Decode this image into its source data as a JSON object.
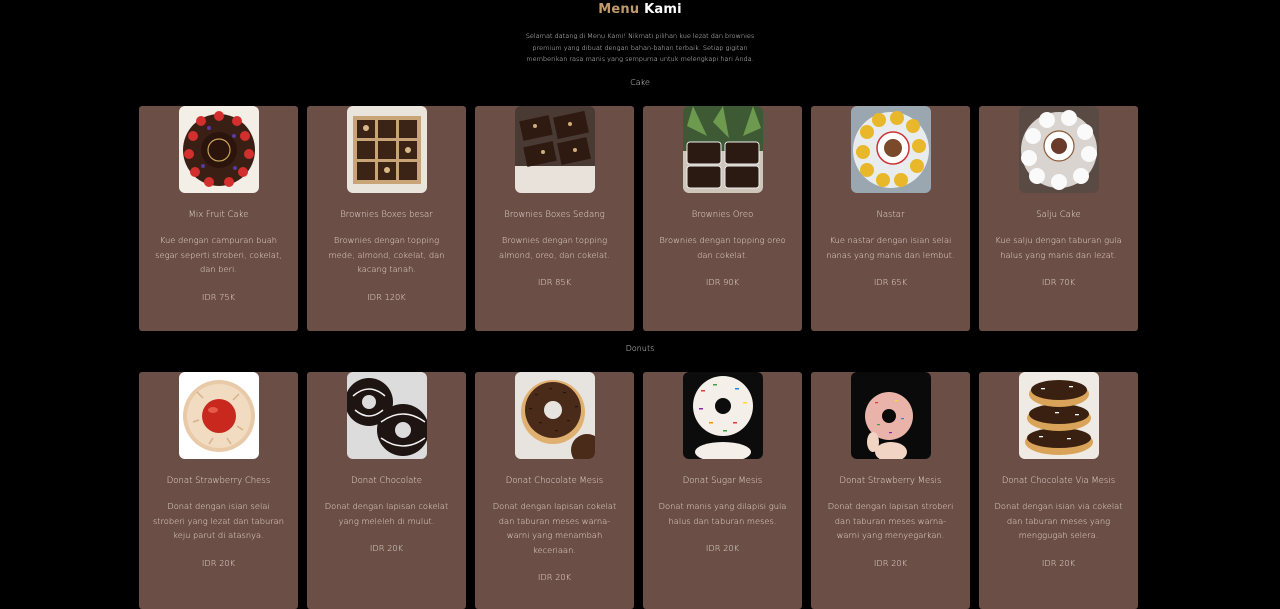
{
  "header": {
    "title_accent": "Menu",
    "title_rest": "Kami",
    "intro": "Selamat datang di Menu Kami! Nikmati pilihan kue lezat dan brownies premium yang dibuat dengan bahan-bahan terbaik. Setiap gigitan memberikan rasa manis yang sempurna untuk melengkapi hari Anda."
  },
  "sections": [
    {
      "label": "Cake",
      "items": [
        {
          "name": "Mix Fruit Cake",
          "desc": "Kue dengan campuran buah segar seperti stroberi, cokelat, dan beri.",
          "price": "IDR 75K"
        },
        {
          "name": "Brownies Boxes besar",
          "desc": "Brownies dengan topping mede, almond, cokelat, dan kacang tanah.",
          "price": "IDR 120K"
        },
        {
          "name": "Brownies Boxes Sedang",
          "desc": "Brownies dengan topping almond, oreo, dan cokelat.",
          "price": "IDR 85K"
        },
        {
          "name": "Brownies Oreo",
          "desc": "Brownies dengan topping oreo dan cokelat.",
          "price": "IDR 90K"
        },
        {
          "name": "Nastar",
          "desc": "Kue nastar dengan isian selai nanas yang manis dan lembut.",
          "price": "IDR 65K"
        },
        {
          "name": "Salju Cake",
          "desc": "Kue salju dengan taburan gula halus yang manis dan lezat.",
          "price": "IDR 70K"
        }
      ]
    },
    {
      "label": "Donuts",
      "items": [
        {
          "name": "Donat Strawberry Chess",
          "desc": "Donat dengan isian selai stroberi yang lezat dan taburan keju parut di atasnya.",
          "price": "IDR 20K"
        },
        {
          "name": "Donat Chocolate",
          "desc": "Donat dengan lapisan cokelat yang meleleh di mulut.",
          "price": "IDR 20K"
        },
        {
          "name": "Donat Chocolate Mesis",
          "desc": "Donat dengan lapisan cokelat dan taburan meses warna-warni yang menambah keceriaan.",
          "price": "IDR 20K"
        },
        {
          "name": "Donat Sugar Mesis",
          "desc": "Donat manis yang dilapisi gula halus dan taburan meses.",
          "price": "IDR 20K"
        },
        {
          "name": "Donat Strawberry Mesis",
          "desc": "Donat dengan lapisan stroberi dan taburan meses warna-warni yang menyegarkan.",
          "price": "IDR 20K"
        },
        {
          "name": "Donat Chocolate Via Mesis",
          "desc": "Donat dengan isian via cokelat dan taburan meses yang menggugah selera.",
          "price": "IDR 20K"
        }
      ]
    }
  ],
  "colors": {
    "background": "#000000",
    "card": "#6b4e45",
    "accent": "#c19a6b"
  }
}
